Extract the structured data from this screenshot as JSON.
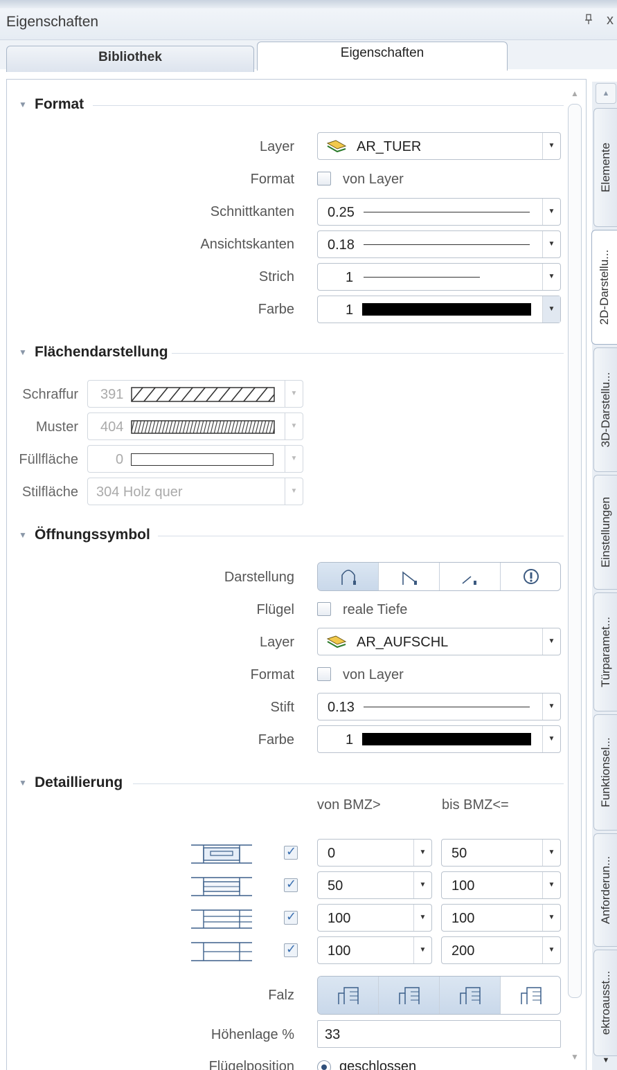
{
  "window": {
    "title": "Eigenschaften",
    "pin_icon": "pin-icon",
    "close_label": "x"
  },
  "tabs": [
    {
      "label": "Bibliothek"
    },
    {
      "label": "Eigenschaften"
    }
  ],
  "side_tabs": [
    "Elemente",
    "2D-Darstellu...",
    "3D-Darstellu...",
    "Einstellungen",
    "Türparamet...",
    "Funktionsel...",
    "Anforderun...",
    "ektroausst..."
  ],
  "format": {
    "title": "Format",
    "layer_label": "Layer",
    "layer_value": "AR_TUER",
    "format_label": "Format",
    "format_check": "von Layer",
    "schnitt_label": "Schnittkanten",
    "schnitt_value": "0.25",
    "ansicht_label": "Ansichtskanten",
    "ansicht_value": "0.18",
    "strich_label": "Strich",
    "strich_value": "1",
    "farbe_label": "Farbe",
    "farbe_value": "1"
  },
  "flaechen": {
    "title": "Flächendarstellung",
    "schraffur_label": "Schraffur",
    "schraffur_value": "391",
    "muster_label": "Muster",
    "muster_value": "404",
    "fuell_label": "Füllfläche",
    "fuell_value": "0",
    "stil_label": "Stilfläche",
    "stil_value": "304 Holz quer"
  },
  "oeffnung": {
    "title": "Öffnungssymbol",
    "darstellung_label": "Darstellung",
    "fluegel_label": "Flügel",
    "fluegel_check": "reale Tiefe",
    "layer_label": "Layer",
    "layer_value": "AR_AUFSCHL",
    "format_label": "Format",
    "format_check": "von Layer",
    "stift_label": "Stift",
    "stift_value": "0.13",
    "farbe_label": "Farbe",
    "farbe_value": "1"
  },
  "detail": {
    "title": "Detaillierung",
    "col_from": "von BMZ>",
    "col_to": "bis BMZ<=",
    "rows": [
      {
        "from": "0",
        "to": "50",
        "checked": true
      },
      {
        "from": "50",
        "to": "100",
        "checked": true
      },
      {
        "from": "100",
        "to": "100",
        "checked": true
      },
      {
        "from": "100",
        "to": "200",
        "checked": true
      }
    ],
    "falz_label": "Falz",
    "hoehe_label": "Höhenlage %",
    "hoehe_value": "33",
    "fluegelpos_label": "Flügelposition",
    "fluegelpos_value": "geschlossen"
  }
}
